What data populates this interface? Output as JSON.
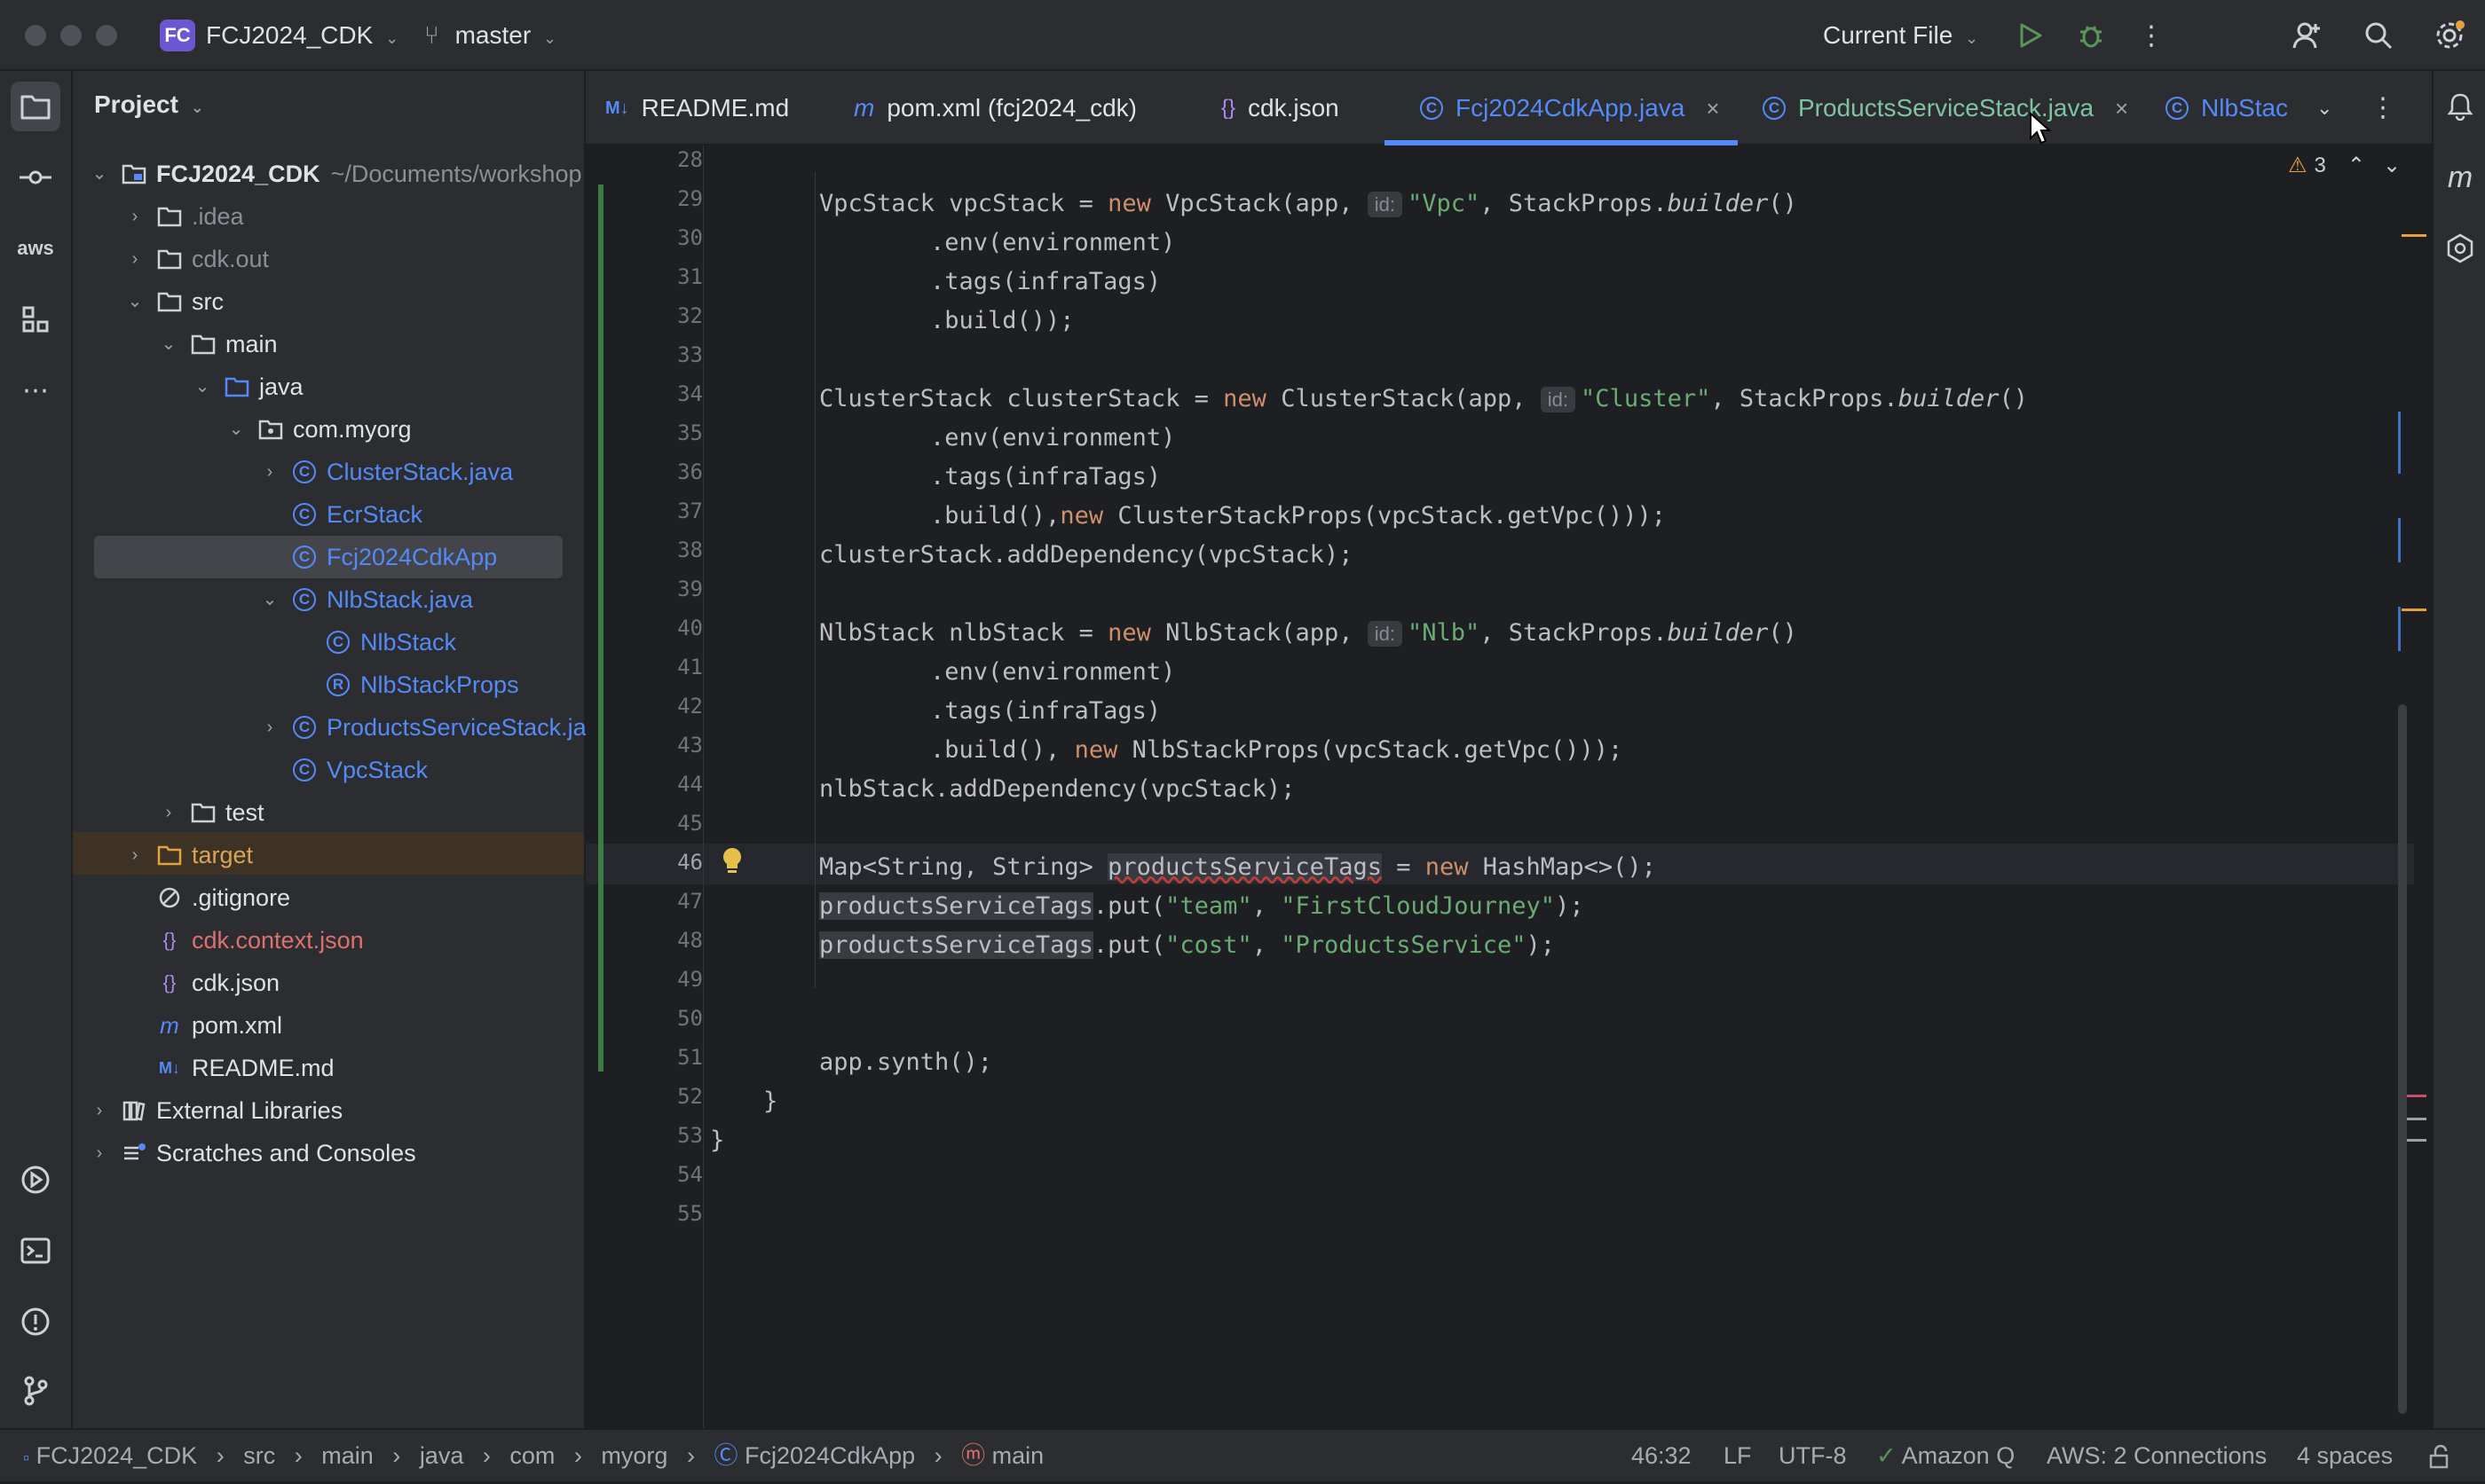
{
  "window": {
    "project_initials": "FC",
    "project_name": "FCJ2024_CDK",
    "branch": "master",
    "run_config": "Current File"
  },
  "project_panel": {
    "title": "Project",
    "root_name": "FCJ2024_CDK",
    "root_path": "~/Documents/workshop",
    "items": [
      {
        "label": ".idea"
      },
      {
        "label": "cdk.out"
      },
      {
        "label": "src"
      },
      {
        "label": "main"
      },
      {
        "label": "java"
      },
      {
        "label": "com.myorg"
      },
      {
        "label": "ClusterStack.java"
      },
      {
        "label": "EcrStack"
      },
      {
        "label": "Fcj2024CdkApp"
      },
      {
        "label": "NlbStack.java"
      },
      {
        "label": "NlbStack"
      },
      {
        "label": "NlbStackProps"
      },
      {
        "label": "ProductsServiceStack.java"
      },
      {
        "label": "VpcStack"
      },
      {
        "label": "test"
      },
      {
        "label": "target"
      },
      {
        "label": ".gitignore"
      },
      {
        "label": "cdk.context.json"
      },
      {
        "label": "cdk.json"
      },
      {
        "label": "pom.xml"
      },
      {
        "label": "README.md"
      },
      {
        "label": "External Libraries"
      },
      {
        "label": "Scratches and Consoles"
      }
    ]
  },
  "tabs": [
    {
      "label": "README.md",
      "icon": "M↓"
    },
    {
      "label": "pom.xml (fcj2024_cdk)",
      "icon": "m"
    },
    {
      "label": "cdk.json",
      "icon": "{}"
    },
    {
      "label": "Fcj2024CdkApp.java",
      "icon": "C"
    },
    {
      "label": "ProductsServiceStack.java",
      "icon": "C"
    },
    {
      "label": "NlbStac",
      "icon": "C"
    }
  ],
  "editor": {
    "warning_count": "3",
    "line_numbers": [
      "28",
      "29",
      "30",
      "31",
      "32",
      "33",
      "34",
      "35",
      "36",
      "37",
      "38",
      "39",
      "40",
      "41",
      "42",
      "43",
      "44",
      "45",
      "46",
      "47",
      "48",
      "49",
      "50",
      "51",
      "52",
      "53",
      "54",
      "55"
    ],
    "code": {
      "l29_a": "VpcStack vpcStack = ",
      "l29_kw": "new",
      "l29_b": " VpcStack(app, ",
      "l29_hint": "id:",
      "l29_str": "\"Vpc\"",
      "l29_c": ", StackProps.",
      "l29_it": "builder",
      "l29_d": "()",
      "l30": ".env(environment)",
      "l31": ".tags(infraTags)",
      "l32": ".build());",
      "l34_a": "ClusterStack clusterStack = ",
      "l34_kw": "new",
      "l34_b": " ClusterStack(app, ",
      "l34_hint": "id:",
      "l34_str": "\"Cluster\"",
      "l34_c": ", StackProps.",
      "l34_it": "builder",
      "l34_d": "()",
      "l35": ".env(environment)",
      "l36": ".tags(infraTags)",
      "l37_a": ".build(),",
      "l37_kw": "new",
      "l37_b": " ClusterStackProps(vpcStack.getVpc()));",
      "l38": "clusterStack.addDependency(vpcStack);",
      "l40_a": "NlbStack nlbStack = ",
      "l40_kw": "new",
      "l40_b": " NlbStack(app, ",
      "l40_hint": "id:",
      "l40_str": "\"Nlb\"",
      "l40_c": ", StackProps.",
      "l40_it": "builder",
      "l40_d": "()",
      "l41": ".env(environment)",
      "l42": ".tags(infraTags)",
      "l43_a": ".build(), ",
      "l43_kw": "new",
      "l43_b": " NlbStackProps(vpcStack.getVpc()));",
      "l44": "nlbStack.addDependency(vpcStack);",
      "l46_a": "Map<String, String> ",
      "l46_var": "productsServiceTags",
      "l46_b": " = ",
      "l46_kw": "new",
      "l46_c": " HashMap<>();",
      "l47_var": "productsServiceTags",
      "l47_a": ".put(",
      "l47_s1": "\"team\"",
      "l47_b": ", ",
      "l47_s2": "\"FirstCloudJourney\"",
      "l47_c": ");",
      "l48_var": "productsServiceTags",
      "l48_a": ".put(",
      "l48_s1": "\"cost\"",
      "l48_b": ", ",
      "l48_s2": "\"ProductsService\"",
      "l48_c": ");",
      "l51": "app.synth();",
      "l52": "}",
      "l53": "}"
    }
  },
  "breadcrumb": [
    "FCJ2024_CDK",
    "src",
    "main",
    "java",
    "com",
    "myorg",
    "Fcj2024CdkApp",
    "main"
  ],
  "status": {
    "position": "46:32",
    "line_ending": "LF",
    "encoding": "UTF-8",
    "amazon_q": "Amazon Q",
    "aws": "AWS: 2 Connections",
    "indent": "4 spaces"
  }
}
